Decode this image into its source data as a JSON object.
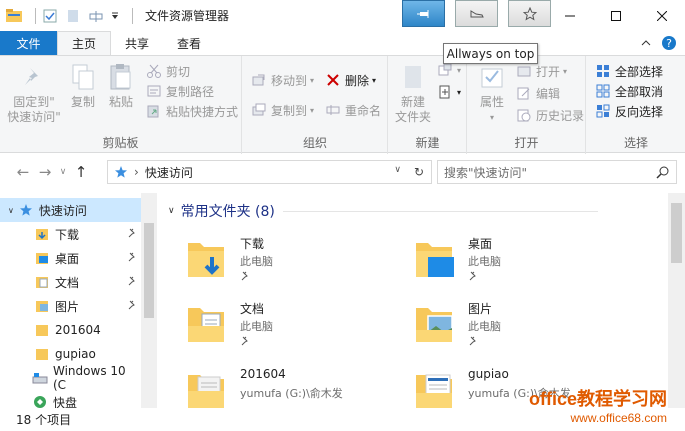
{
  "window": {
    "title": "文件资源管理器"
  },
  "tooltip": "Allways on top",
  "tabs": {
    "file": "文件",
    "home": "主页",
    "share": "共享",
    "view": "查看"
  },
  "ribbon": {
    "clipboard": {
      "label": "剪贴板",
      "pin": "固定到\"\n快速访问\"",
      "copy": "复制",
      "paste": "粘贴",
      "cut": "剪切",
      "copy_path": "复制路径",
      "paste_shortcut": "粘贴快捷方式"
    },
    "organize": {
      "label": "组织",
      "move_to": "移动到",
      "copy_to": "复制到",
      "delete": "删除",
      "rename": "重命名"
    },
    "new": {
      "label": "新建",
      "new_folder": "新建\n文件夹"
    },
    "open": {
      "label": "打开",
      "properties": "属性",
      "open": "打开",
      "edit": "编辑",
      "history": "历史记录"
    },
    "select": {
      "label": "选择",
      "select_all": "全部选择",
      "select_none": "全部取消",
      "invert": "反向选择"
    }
  },
  "address": {
    "path": "快速访问",
    "search_placeholder": "搜索\"快速访问\""
  },
  "nav": {
    "items": [
      {
        "label": "快速访问"
      },
      {
        "label": "下载"
      },
      {
        "label": "桌面"
      },
      {
        "label": "文档"
      },
      {
        "label": "图片"
      },
      {
        "label": "201604"
      },
      {
        "label": "gupiao"
      },
      {
        "label": "Windows 10 (C"
      },
      {
        "label": "快盘"
      }
    ]
  },
  "content": {
    "group_title": "常用文件夹 (8)",
    "tiles": [
      {
        "name": "下载",
        "sub": "此电脑"
      },
      {
        "name": "桌面",
        "sub": "此电脑"
      },
      {
        "name": "文档",
        "sub": "此电脑"
      },
      {
        "name": "图片",
        "sub": "此电脑"
      },
      {
        "name": "201604",
        "sub": "yumufa (G:)\\俞木发"
      },
      {
        "name": "gupiao",
        "sub": "yumufa (G:)\\俞木发"
      }
    ]
  },
  "status": {
    "count": "18 个项目"
  },
  "watermark": {
    "line1": "office教程学习网",
    "line2": "www.office68.com"
  },
  "colors": {
    "accent": "#1979ca",
    "selection": "#cce8ff",
    "folder": "#f7c85a",
    "group_title": "#1e3287"
  }
}
